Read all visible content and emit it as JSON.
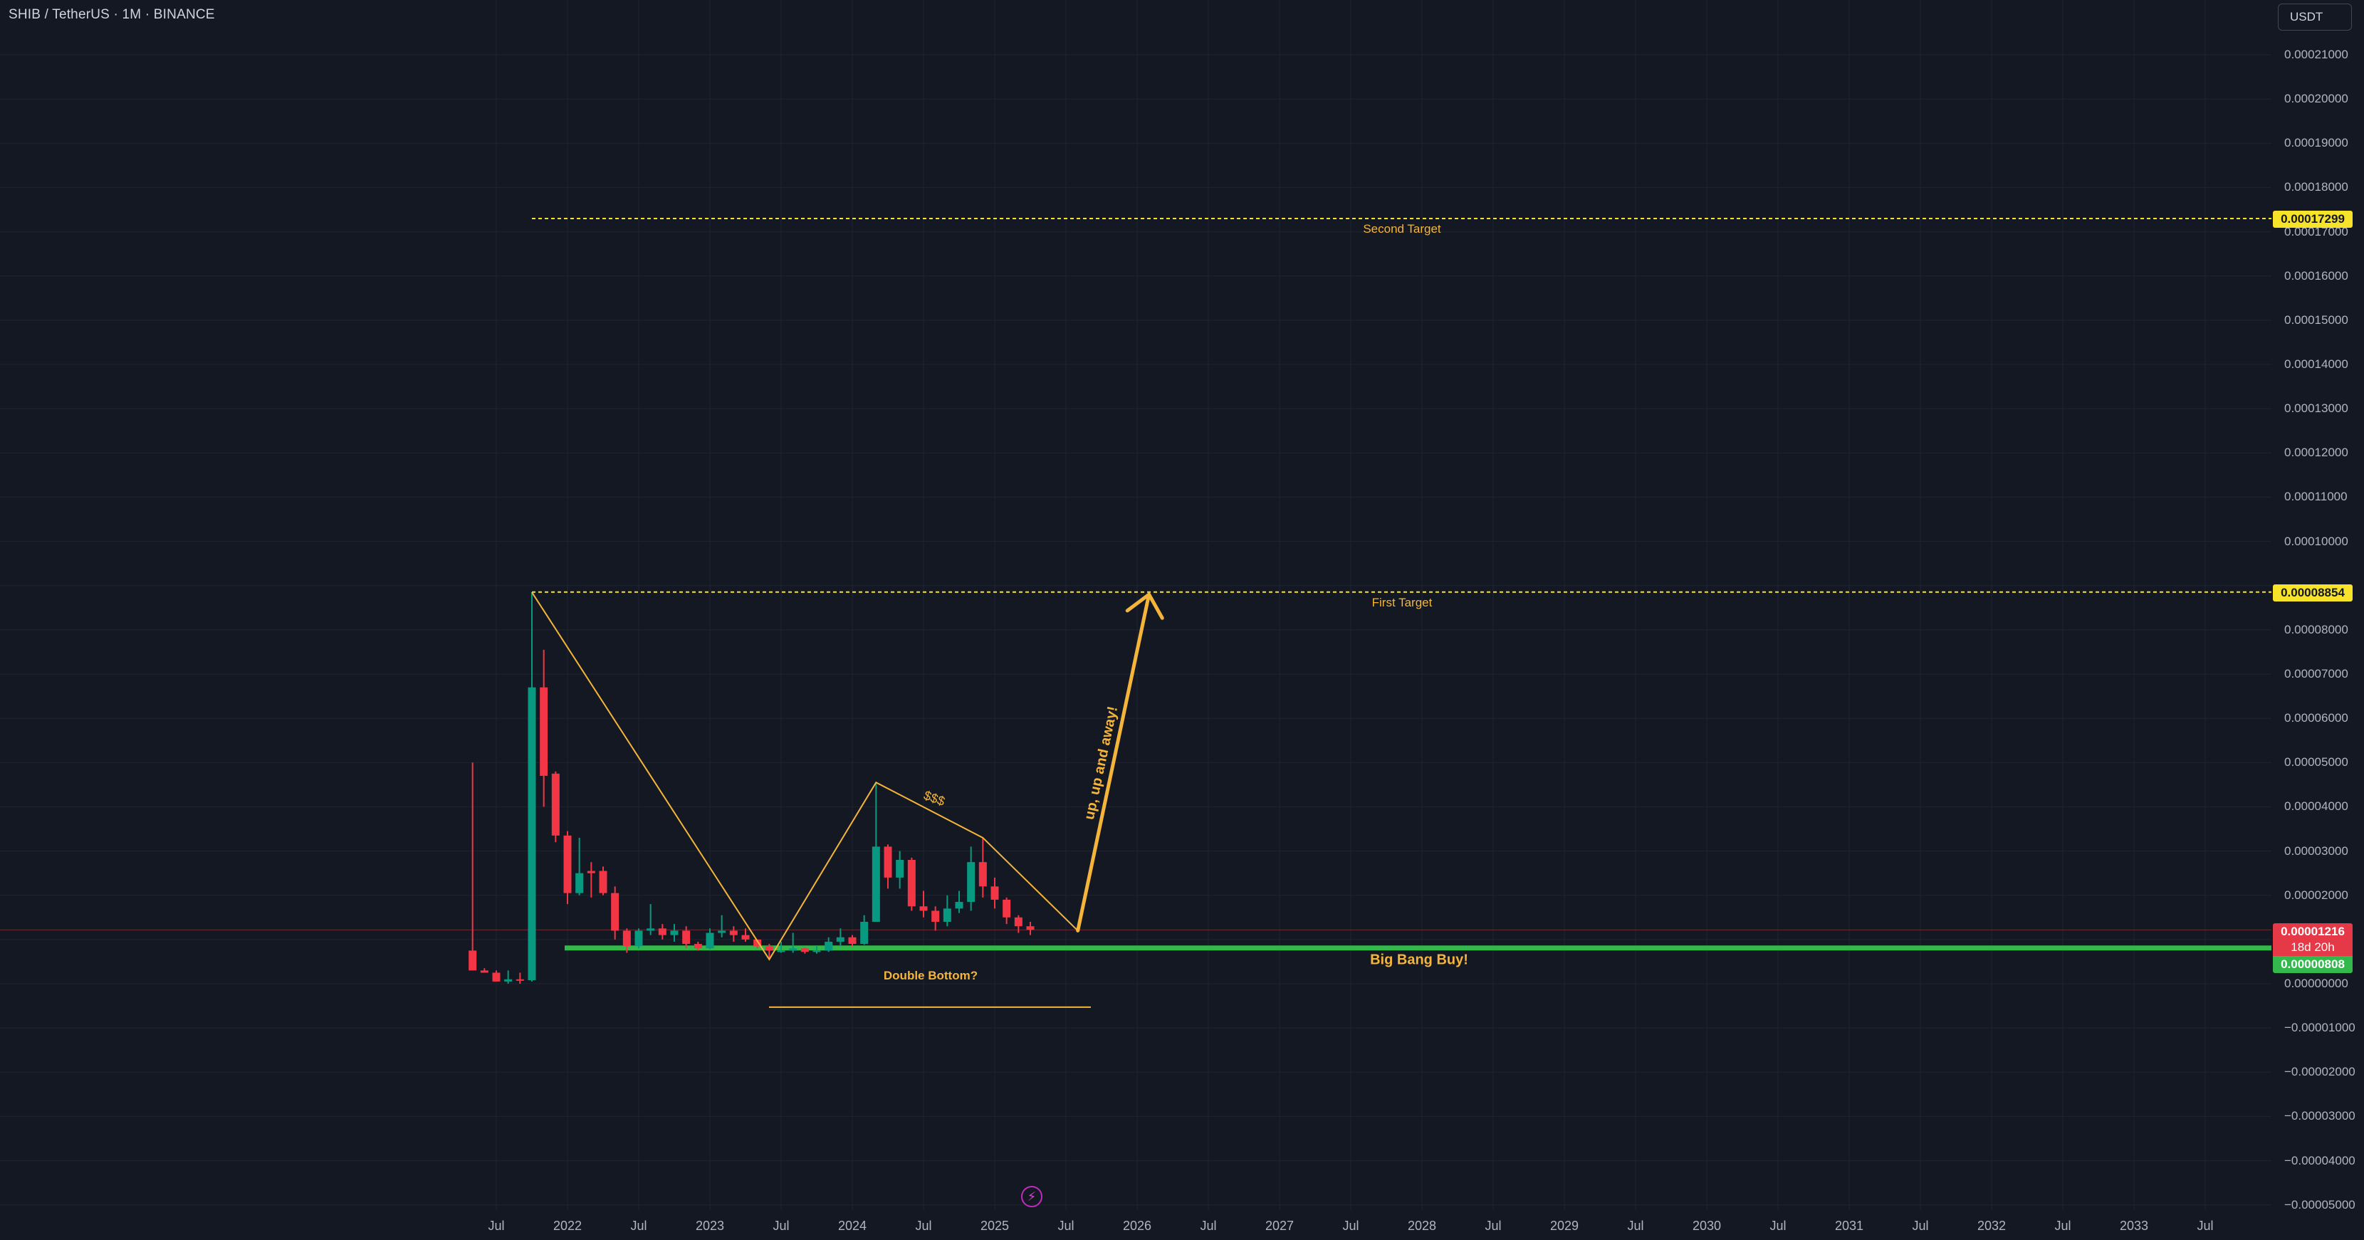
{
  "header": {
    "symbol_title": "SHIB / TetherUS · 1M · BINANCE",
    "currency": "USDT"
  },
  "colors": {
    "background": "#141823",
    "up": "#089981",
    "down": "#f23645",
    "annotation": "#f5b43a",
    "target_line": "#f6e32a",
    "support": "#33b84b",
    "last_price": "#e53947"
  },
  "icons": {
    "lightning": "lightning-icon"
  },
  "price_axis": {
    "ticks": [
      "0.00021000",
      "0.00020000",
      "0.00019000",
      "0.00018000",
      "0.00017000",
      "0.00016000",
      "0.00015000",
      "0.00014000",
      "0.00013000",
      "0.00012000",
      "0.00011000",
      "0.00010000",
      "0.00008000",
      "0.00007000",
      "0.00006000",
      "0.00005000",
      "0.00004000",
      "0.00003000",
      "0.00002000",
      "0.00000000",
      "−0.00001000",
      "−0.00002000",
      "−0.00003000",
      "−0.00004000",
      "−0.00005000"
    ]
  },
  "time_axis": {
    "ticks": [
      "Jul",
      "2022",
      "Jul",
      "2023",
      "Jul",
      "2024",
      "Jul",
      "2025",
      "Jul",
      "2026",
      "Jul",
      "2027",
      "Jul",
      "2028",
      "Jul",
      "2029",
      "Jul",
      "2030",
      "Jul",
      "2031",
      "Jul",
      "2032",
      "Jul",
      "2033",
      "Jul"
    ]
  },
  "price_labels": {
    "second_target": "0.00017299",
    "first_target": "0.00008854",
    "current_price": "0.00001216",
    "countdown": "18d 20h",
    "support": "0.00000808"
  },
  "annotations": {
    "second_target": "Second Target",
    "first_target": "First Target",
    "big_bang": "Big Bang Buy!",
    "double_bottom": "Double Bottom?",
    "dollars": "$$$",
    "up_away": "up, up and away!"
  },
  "chart_data": {
    "type": "candlestick",
    "title": "SHIB / TetherUS · 1M · BINANCE",
    "interval": "1M",
    "ylim": [
      -5e-05,
      0.000215
    ],
    "xlim": [
      "2021-03",
      "2034-01"
    ],
    "grid": true,
    "series": [
      {
        "name": "SHIB / TetherUS",
        "points": [
          {
            "t": "2021-05",
            "o": 7.5e-06,
            "h": 5e-05,
            "l": 3.5e-06,
            "c": 3e-06
          },
          {
            "t": "2021-06",
            "o": 3e-06,
            "h": 3.5e-06,
            "l": 2.5e-06,
            "c": 2.5e-06
          },
          {
            "t": "2021-07",
            "o": 2.5e-06,
            "h": 3e-06,
            "l": 5e-07,
            "c": 5e-07
          },
          {
            "t": "2021-08",
            "o": 5e-07,
            "h": 3e-06,
            "l": 0.0,
            "c": 1e-06
          },
          {
            "t": "2021-09",
            "o": 1e-06,
            "h": 2.5e-06,
            "l": 0.0,
            "c": 8e-07
          },
          {
            "t": "2021-10",
            "o": 8e-07,
            "h": 8.85e-05,
            "l": 5e-07,
            "c": 6.7e-05
          },
          {
            "t": "2021-11",
            "o": 6.7e-05,
            "h": 7.55e-05,
            "l": 4e-05,
            "c": 4.7e-05
          },
          {
            "t": "2021-12",
            "o": 4.75e-05,
            "h": 4.8e-05,
            "l": 3.2e-05,
            "c": 3.35e-05
          },
          {
            "t": "2022-01",
            "o": 3.35e-05,
            "h": 3.45e-05,
            "l": 1.8e-05,
            "c": 2.05e-05
          },
          {
            "t": "2022-02",
            "o": 2.05e-05,
            "h": 3.3e-05,
            "l": 2e-05,
            "c": 2.5e-05
          },
          {
            "t": "2022-03",
            "o": 2.55e-05,
            "h": 2.75e-05,
            "l": 1.95e-05,
            "c": 2.5e-05
          },
          {
            "t": "2022-04",
            "o": 2.55e-05,
            "h": 2.65e-05,
            "l": 2e-05,
            "c": 2.05e-05
          },
          {
            "t": "2022-05",
            "o": 2.05e-05,
            "h": 2.2e-05,
            "l": 1e-05,
            "c": 1.2e-05
          },
          {
            "t": "2022-06",
            "o": 1.2e-05,
            "h": 1.25e-05,
            "l": 7e-06,
            "c": 8.5e-06
          },
          {
            "t": "2022-07",
            "o": 8.5e-06,
            "h": 1.25e-05,
            "l": 8e-06,
            "c": 1.2e-05
          },
          {
            "t": "2022-08",
            "o": 1.2e-05,
            "h": 1.8e-05,
            "l": 1.1e-05,
            "c": 1.25e-05
          },
          {
            "t": "2022-09",
            "o": 1.25e-05,
            "h": 1.35e-05,
            "l": 1e-05,
            "c": 1.1e-05
          },
          {
            "t": "2022-10",
            "o": 1.1e-05,
            "h": 1.35e-05,
            "l": 9.5e-06,
            "c": 1.2e-05
          },
          {
            "t": "2022-11",
            "o": 1.2e-05,
            "h": 1.3e-05,
            "l": 8e-06,
            "c": 9e-06
          },
          {
            "t": "2022-12",
            "o": 9e-06,
            "h": 9.5e-06,
            "l": 7.5e-06,
            "c": 8e-06
          },
          {
            "t": "2023-01",
            "o": 8e-06,
            "h": 1.25e-05,
            "l": 7.8e-06,
            "c": 1.15e-05
          },
          {
            "t": "2023-02",
            "o": 1.15e-05,
            "h": 1.55e-05,
            "l": 1.05e-05,
            "c": 1.2e-05
          },
          {
            "t": "2023-03",
            "o": 1.2e-05,
            "h": 1.3e-05,
            "l": 9.5e-06,
            "c": 1.1e-05
          },
          {
            "t": "2023-04",
            "o": 1.1e-05,
            "h": 1.25e-05,
            "l": 9.5e-06,
            "c": 1e-05
          },
          {
            "t": "2023-05",
            "o": 1e-05,
            "h": 1e-05,
            "l": 8e-06,
            "c": 8.5e-06
          },
          {
            "t": "2023-06",
            "o": 8.5e-06,
            "h": 9e-06,
            "l": 5.5e-06,
            "c": 7.5e-06
          },
          {
            "t": "2023-07",
            "o": 7.5e-06,
            "h": 9.5e-06,
            "l": 7e-06,
            "c": 7.5e-06
          },
          {
            "t": "2023-08",
            "o": 7.5e-06,
            "h": 1.15e-05,
            "l": 7e-06,
            "c": 8e-06
          },
          {
            "t": "2023-09",
            "o": 8e-06,
            "h": 8.2e-06,
            "l": 6.8e-06,
            "c": 7.2e-06
          },
          {
            "t": "2023-10",
            "o": 7.2e-06,
            "h": 8.5e-06,
            "l": 6.8e-06,
            "c": 7.5e-06
          },
          {
            "t": "2023-11",
            "o": 7.5e-06,
            "h": 1.05e-05,
            "l": 7.2e-06,
            "c": 9.5e-06
          },
          {
            "t": "2023-12",
            "o": 9.5e-06,
            "h": 1.25e-05,
            "l": 8.5e-06,
            "c": 1.05e-05
          },
          {
            "t": "2024-01",
            "o": 1.05e-05,
            "h": 1.1e-05,
            "l": 8.5e-06,
            "c": 9e-06
          },
          {
            "t": "2024-02",
            "o": 9e-06,
            "h": 1.55e-05,
            "l": 8.8e-06,
            "c": 1.4e-05
          },
          {
            "t": "2024-03",
            "o": 1.4e-05,
            "h": 4.55e-05,
            "l": 1.4e-05,
            "c": 3.1e-05
          },
          {
            "t": "2024-04",
            "o": 3.1e-05,
            "h": 3.15e-05,
            "l": 2.15e-05,
            "c": 2.4e-05
          },
          {
            "t": "2024-05",
            "o": 2.4e-05,
            "h": 3e-05,
            "l": 2.15e-05,
            "c": 2.8e-05
          },
          {
            "t": "2024-06",
            "o": 2.8e-05,
            "h": 2.85e-05,
            "l": 1.65e-05,
            "c": 1.75e-05
          },
          {
            "t": "2024-07",
            "o": 1.75e-05,
            "h": 2.1e-05,
            "l": 1.5e-05,
            "c": 1.65e-05
          },
          {
            "t": "2024-08",
            "o": 1.65e-05,
            "h": 1.75e-05,
            "l": 1.2e-05,
            "c": 1.4e-05
          },
          {
            "t": "2024-09",
            "o": 1.4e-05,
            "h": 2e-05,
            "l": 1.3e-05,
            "c": 1.7e-05
          },
          {
            "t": "2024-10",
            "o": 1.7e-05,
            "h": 2.1e-05,
            "l": 1.6e-05,
            "c": 1.85e-05
          },
          {
            "t": "2024-11",
            "o": 1.85e-05,
            "h": 3.1e-05,
            "l": 1.65e-05,
            "c": 2.75e-05
          },
          {
            "t": "2024-12",
            "o": 2.75e-05,
            "h": 3.3e-05,
            "l": 1.95e-05,
            "c": 2.2e-05
          },
          {
            "t": "2025-01",
            "o": 2.2e-05,
            "h": 2.4e-05,
            "l": 1.7e-05,
            "c": 1.9e-05
          },
          {
            "t": "2025-02",
            "o": 1.9e-05,
            "h": 1.95e-05,
            "l": 1.35e-05,
            "c": 1.5e-05
          },
          {
            "t": "2025-03",
            "o": 1.5e-05,
            "h": 1.55e-05,
            "l": 1.15e-05,
            "c": 1.3e-05
          },
          {
            "t": "2025-04",
            "o": 1.3e-05,
            "h": 1.4e-05,
            "l": 1.1e-05,
            "c": 1.22e-05
          }
        ]
      }
    ],
    "horizontal_levels": [
      {
        "label": "Second Target",
        "value": 0.00017299
      },
      {
        "label": "First Target",
        "value": 8.854e-05
      },
      {
        "label": "Big Bang Buy!",
        "value": 8.08e-06
      },
      {
        "label": "Double Bottom?",
        "value": -5.3e-06
      }
    ],
    "trendlines": [
      {
        "points": [
          [
            "2021-10",
            8.85e-05
          ],
          [
            "2023-06",
            5.5e-06
          ],
          [
            "2024-03",
            4.55e-05
          ],
          [
            "2024-12",
            3.3e-05
          ],
          [
            "2025-08",
            1.2e-05
          ]
        ]
      }
    ],
    "arrow": {
      "from": [
        "2025-08",
        1.2e-05
      ],
      "to": [
        "2026-02",
        8.8e-05
      ],
      "label": "up, up and away!"
    }
  }
}
